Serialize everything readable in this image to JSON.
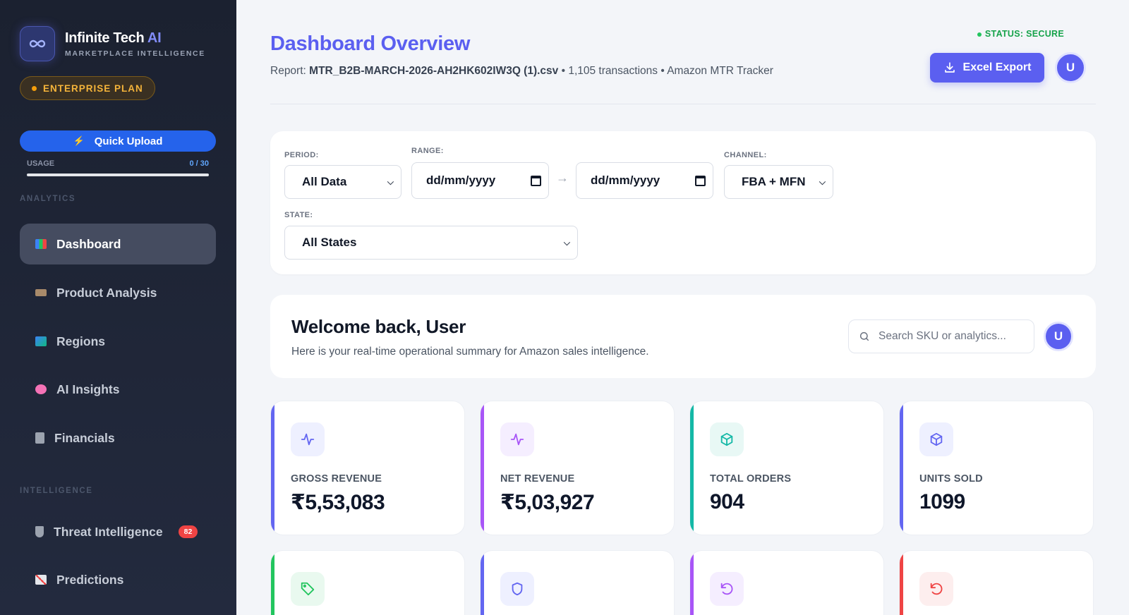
{
  "brand": {
    "name": "Infinite Tech",
    "name_ai": "AI",
    "subtitle": "MARKETPLACE INTELLIGENCE",
    "plan": "ENTERPRISE PLAN"
  },
  "sidebar": {
    "quick_upload": "Quick Upload",
    "usage_label": "USAGE",
    "usage_value": "0 / 30",
    "usage_fraction": 0.0,
    "sections": {
      "analytics": "ANALYTICS",
      "intelligence": "INTELLIGENCE"
    },
    "items": [
      {
        "label": "Dashboard",
        "icon": "bar-chart-icon"
      },
      {
        "label": "Product Analysis",
        "icon": "tag-icon"
      },
      {
        "label": "Regions",
        "icon": "map-icon"
      },
      {
        "label": "AI Insights",
        "icon": "brain-icon"
      },
      {
        "label": "Financials",
        "icon": "calculator-icon"
      },
      {
        "label": "Threat Intelligence",
        "icon": "shield-icon",
        "badge": "82"
      },
      {
        "label": "Predictions",
        "icon": "trend-chart-icon"
      }
    ]
  },
  "header": {
    "title": "Dashboard Overview",
    "report_prefix": "Report:",
    "report_file": "MTR_B2B-MARCH-2026-AH2HK602IW3Q (1).csv",
    "report_suffix": "• 1,105 transactions • Amazon MTR Tracker",
    "status": "STATUS: SECURE",
    "export_label": "Excel Export",
    "avatar": "U"
  },
  "filters": {
    "period_label": "PERIOD:",
    "period_value": "All Data",
    "range_label": "RANGE:",
    "range_from": "dd/mm/yyyy",
    "range_arrow": "→",
    "range_to": "dd/mm/yyyy",
    "channel_label": "CHANNEL:",
    "channel_value": "FBA + MFN",
    "state_label": "STATE:",
    "state_value": "All States"
  },
  "welcome": {
    "title": "Welcome back, User",
    "subtitle": "Here is your real-time operational summary for Amazon sales intelligence.",
    "search_placeholder": "Search SKU or analytics...",
    "avatar": "U"
  },
  "kpis": [
    {
      "label": "GROSS REVENUE",
      "value": "₹5,53,083",
      "color": "#6366f1",
      "icon": "activity-icon"
    },
    {
      "label": "NET REVENUE",
      "value": "₹5,03,927",
      "color": "#a855f7",
      "icon": "activity-icon"
    },
    {
      "label": "TOTAL ORDERS",
      "value": "904",
      "color": "#14b8a6",
      "icon": "package-icon"
    },
    {
      "label": "UNITS SOLD",
      "value": "1099",
      "color": "#6366f1",
      "icon": "package-icon"
    }
  ],
  "kpis_row2": [
    {
      "color": "#22c55e",
      "icon": "tag-icon"
    },
    {
      "color": "#6366f1",
      "icon": "shield-icon"
    },
    {
      "color": "#a855f7",
      "icon": "rotate-ccw-icon"
    },
    {
      "color": "#ef4444",
      "icon": "rotate-ccw-icon"
    }
  ]
}
